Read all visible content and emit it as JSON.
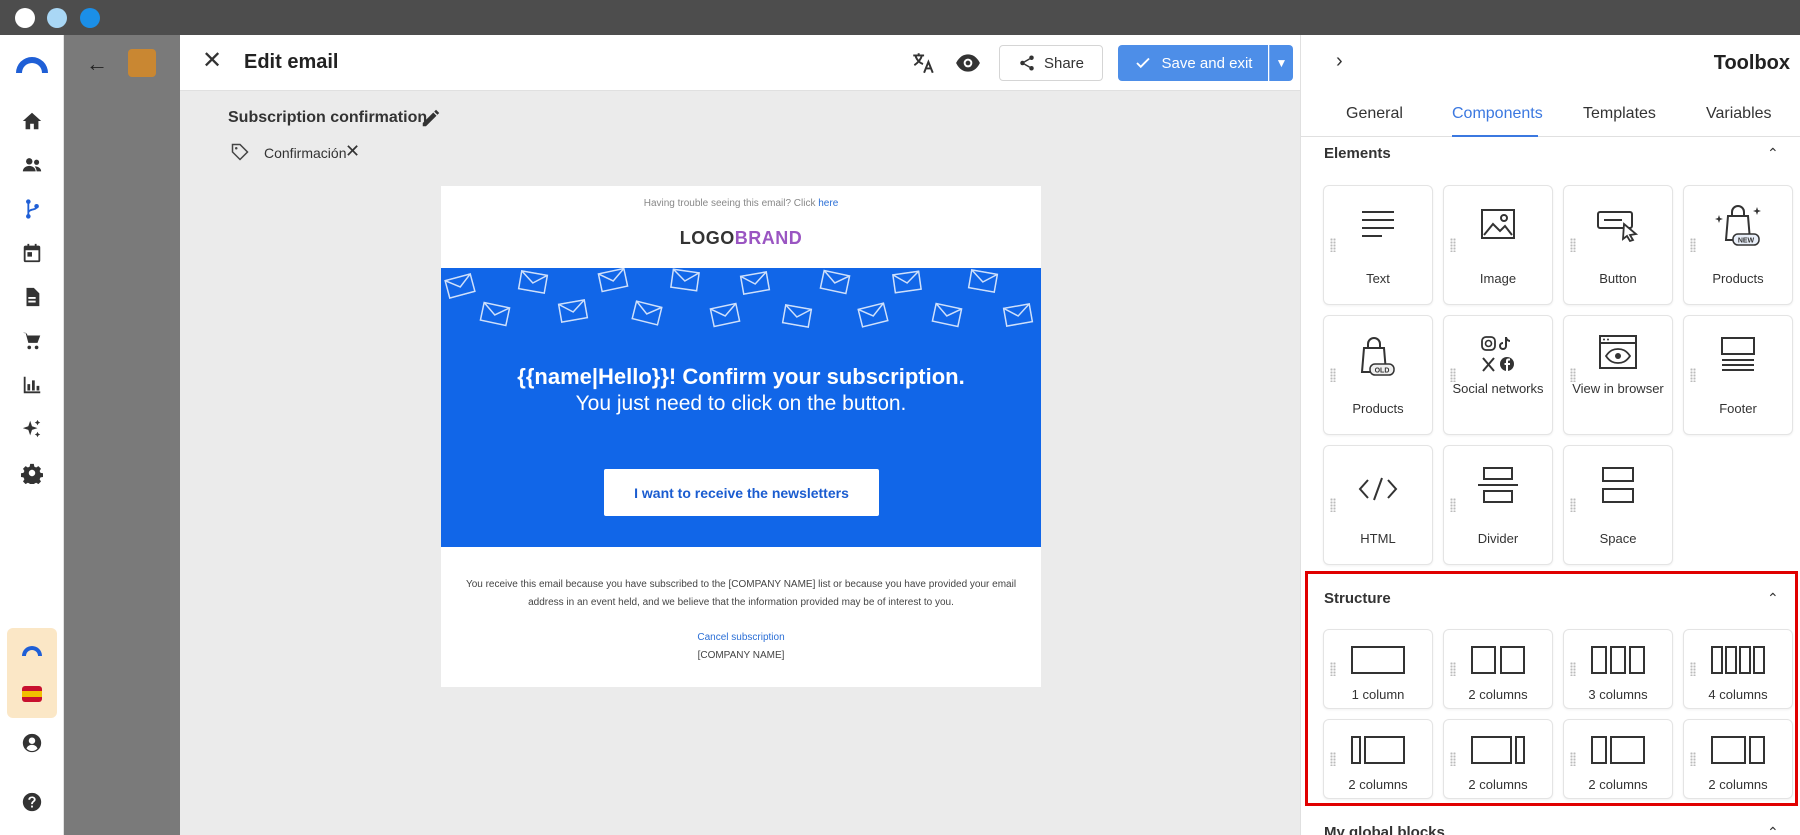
{
  "editor": {
    "title": "Edit email",
    "share_label": "Share",
    "save_label": "Save and exit",
    "subject": "Subscription confirmation",
    "tag": "Confirmación"
  },
  "email": {
    "trouble_text": "Having trouble seeing this email? Click ",
    "trouble_link": "here",
    "logo_part1": "LOGO",
    "logo_part2": "BRAND",
    "hero_line1": "{{name|Hello}}! Confirm your subscription.",
    "hero_line2": "You just need to click on the button.",
    "cta_label": "I want to receive the newsletters",
    "footer_text": "You receive this email because you have subscribed to the [COMPANY NAME] list or because you have provided your email address in an event held, and we believe that the information provided may be of interest to you.",
    "cancel_link": "Cancel subscription",
    "company": "[COMPANY NAME]"
  },
  "toolbox": {
    "title": "Toolbox",
    "tabs": [
      "General",
      "Components",
      "Templates",
      "Variables"
    ],
    "active_tab": "Components",
    "elements_title": "Elements",
    "elements": [
      "Text",
      "Image",
      "Button",
      "Products",
      "Products",
      "Social networks",
      "View in browser",
      "Footer",
      "HTML",
      "Divider",
      "Space"
    ],
    "badges": {
      "new": "NEW",
      "old": "OLD"
    },
    "structure_title": "Structure",
    "structure": [
      "1 column",
      "2 columns",
      "3 columns",
      "4 columns",
      "2 columns",
      "2 columns",
      "2 columns",
      "2 columns"
    ],
    "global_blocks_title": "My global blocks"
  },
  "colors": {
    "accent": "#3b78e0",
    "save_button": "#4d8ee8",
    "hero_blue": "#1166e8",
    "brand_purple": "#9a55c2",
    "highlight": "#e00000"
  }
}
